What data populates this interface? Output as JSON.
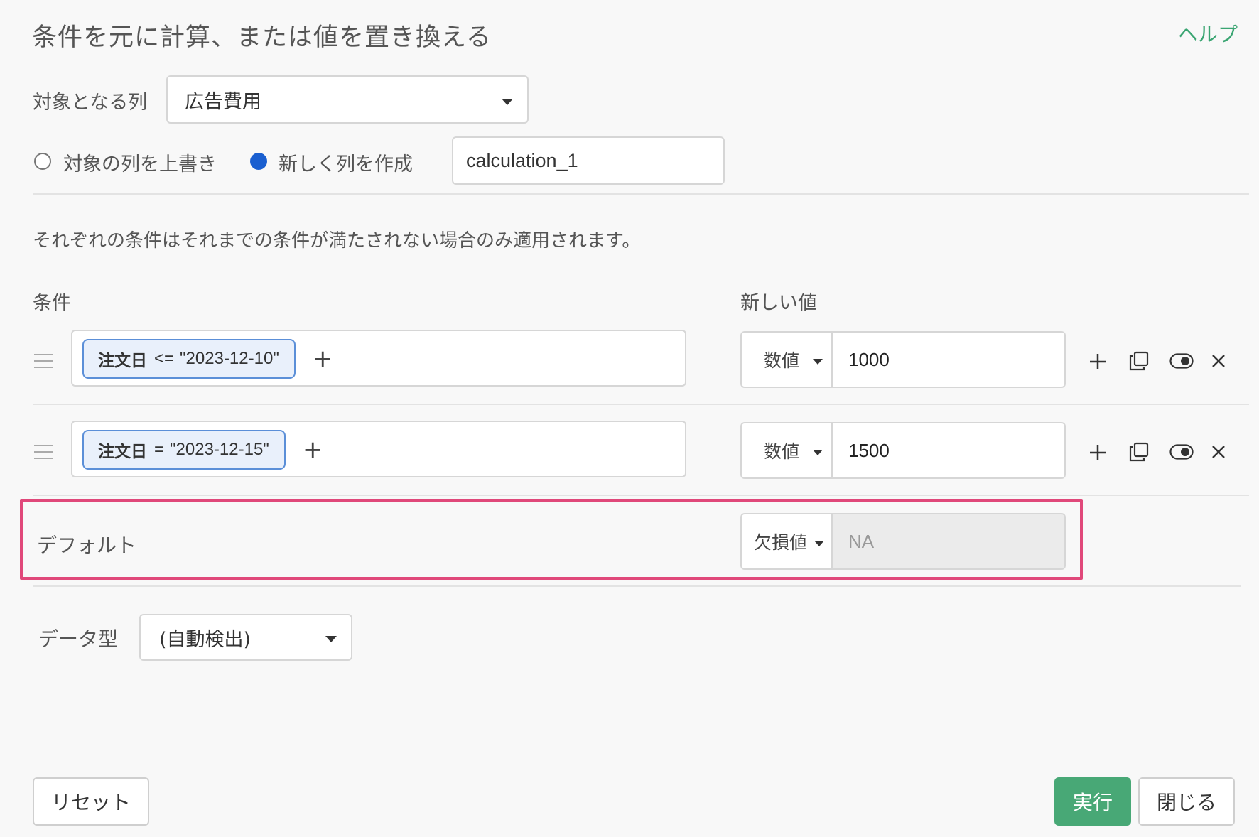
{
  "dialog": {
    "title": "条件を元に計算、または値を置き換える",
    "help_label": "ヘルプ"
  },
  "target_column": {
    "label": "対象となる列",
    "selected": "広告費用"
  },
  "mode": {
    "overwrite_label": "対象の列を上書き",
    "create_label": "新しく列を作成",
    "selected": "create",
    "new_column_name": "calculation_1"
  },
  "note": "それぞれの条件はそれまでの条件が満たされない場合のみ適用されます。",
  "headers": {
    "condition": "条件",
    "new_value": "新しい値"
  },
  "conditions": [
    {
      "column": "注文日",
      "operator": "<=",
      "value": "\"2023-12-10\"",
      "value_type": "数値",
      "new_value": "1000"
    },
    {
      "column": "注文日",
      "operator": "=",
      "value": "\"2023-12-15\"",
      "value_type": "数値",
      "new_value": "1500"
    }
  ],
  "default": {
    "label": "デフォルト",
    "value_type": "欠損値",
    "value": "NA"
  },
  "data_type": {
    "label": "データ型",
    "selected": "(自動検出)"
  },
  "footer": {
    "reset_label": "リセット",
    "run_label": "実行",
    "close_label": "閉じる"
  },
  "colors": {
    "accent_green": "#48a876",
    "help_green": "#3aa572",
    "highlight_pink": "#e0487a",
    "radio_blue": "#1a5fd0",
    "chip_border": "#5b8fd8"
  },
  "icons": [
    "add-icon",
    "copy-icon",
    "toggle-icon",
    "close-icon",
    "drag-handle-icon",
    "caret-down-icon"
  ]
}
